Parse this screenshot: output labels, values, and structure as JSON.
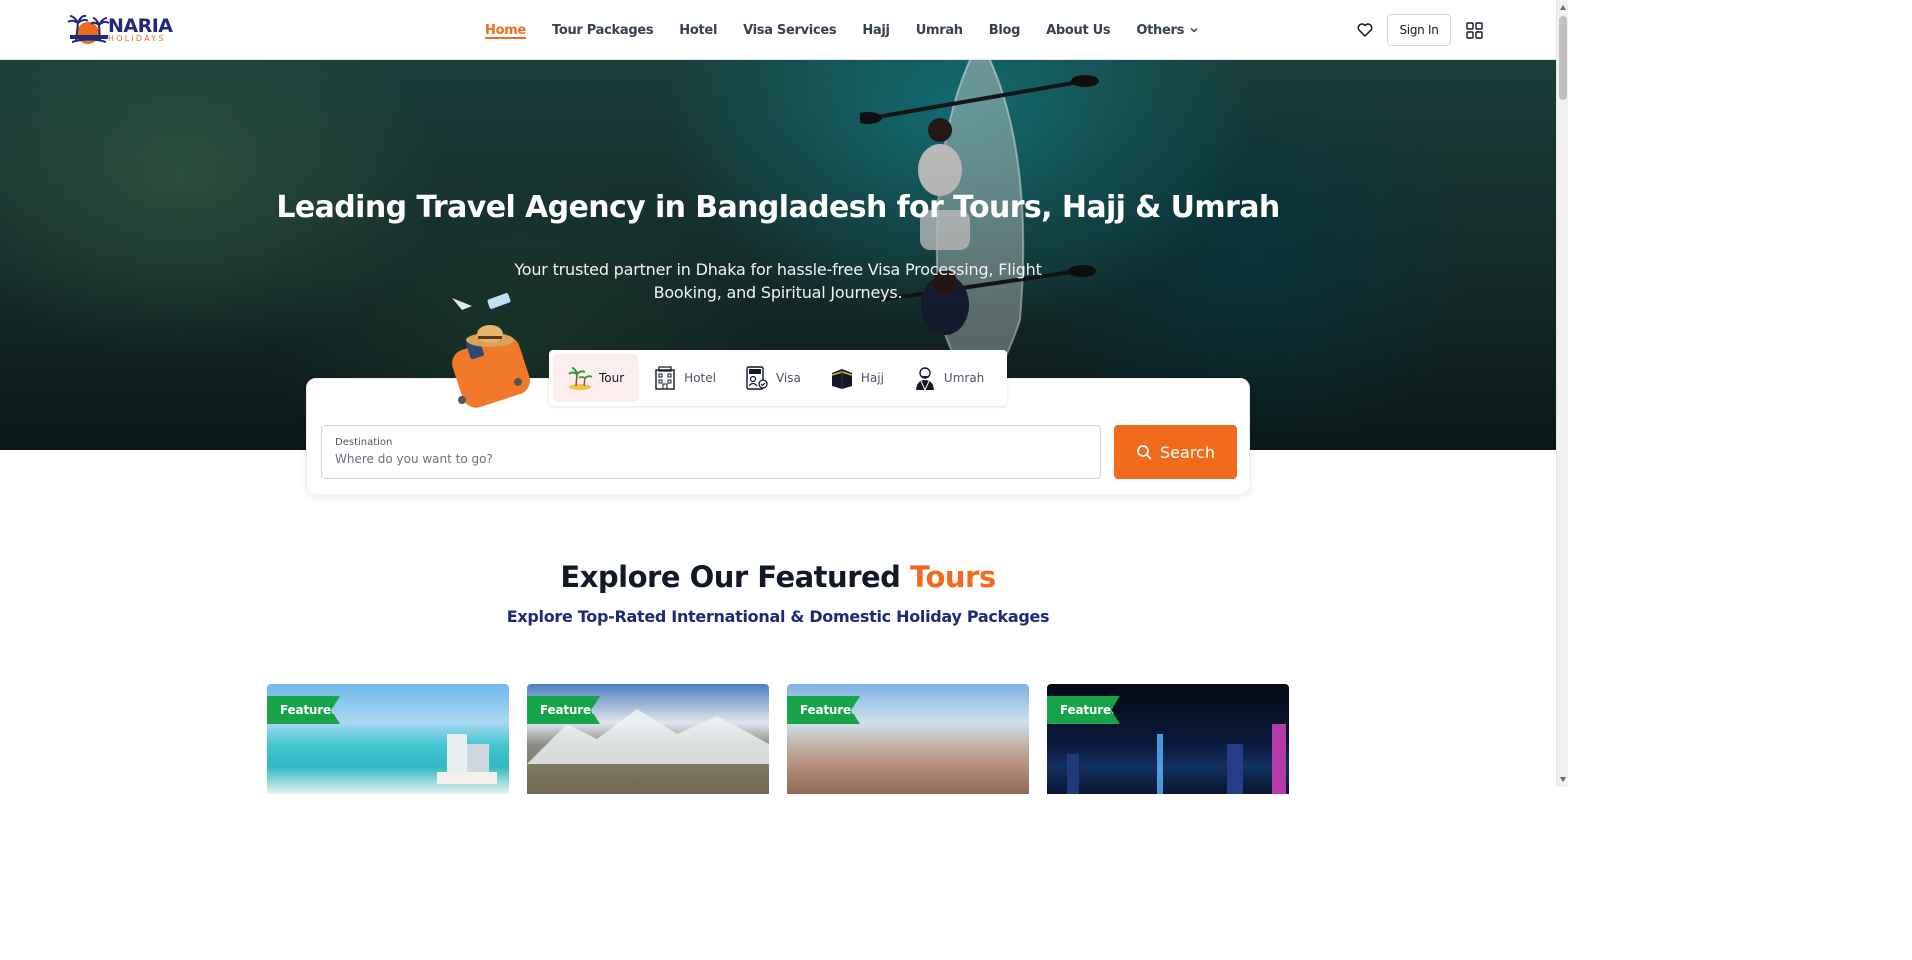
{
  "brand": {
    "name": "NARIA",
    "tagline": "HOLIDAYS",
    "primary_color": "#f26b1d",
    "navy_color": "#1e2a78"
  },
  "nav": {
    "items": [
      {
        "label": "Home",
        "active": true
      },
      {
        "label": "Tour Packages"
      },
      {
        "label": "Hotel"
      },
      {
        "label": "Visa Services"
      },
      {
        "label": "Hajj"
      },
      {
        "label": "Umrah"
      },
      {
        "label": "Blog"
      },
      {
        "label": "About Us"
      },
      {
        "label": "Others",
        "has_dropdown": true
      }
    ],
    "sign_in_label": "Sign In"
  },
  "hero": {
    "title": "Leading Travel Agency in Bangladesh for Tours, Hajj & Umrah",
    "subtitle": "Your trusted partner in Dhaka for hassle-free Visa Processing, Flight Booking, and Spiritual Journeys."
  },
  "search": {
    "tabs": [
      {
        "label": "Tour",
        "icon": "palm-tree-icon",
        "active": true
      },
      {
        "label": "Hotel",
        "icon": "hotel-icon"
      },
      {
        "label": "Visa",
        "icon": "visa-icon"
      },
      {
        "label": "Hajj",
        "icon": "kaaba-icon"
      },
      {
        "label": "Umrah",
        "icon": "pilgrim-icon"
      }
    ],
    "destination_label": "Destination",
    "destination_placeholder": "Where do you want to go?",
    "destination_value": "",
    "button_label": "Search"
  },
  "featured": {
    "title_main": "Explore Our Featured ",
    "title_accent": "Tours",
    "subtitle": "Explore Top-Rated International & Domestic Holiday Packages",
    "badge_color": "#16a34a",
    "cards": [
      {
        "badge": "Featured"
      },
      {
        "badge": "Featured"
      },
      {
        "badge": "Featured"
      },
      {
        "badge": "Featured"
      }
    ]
  }
}
